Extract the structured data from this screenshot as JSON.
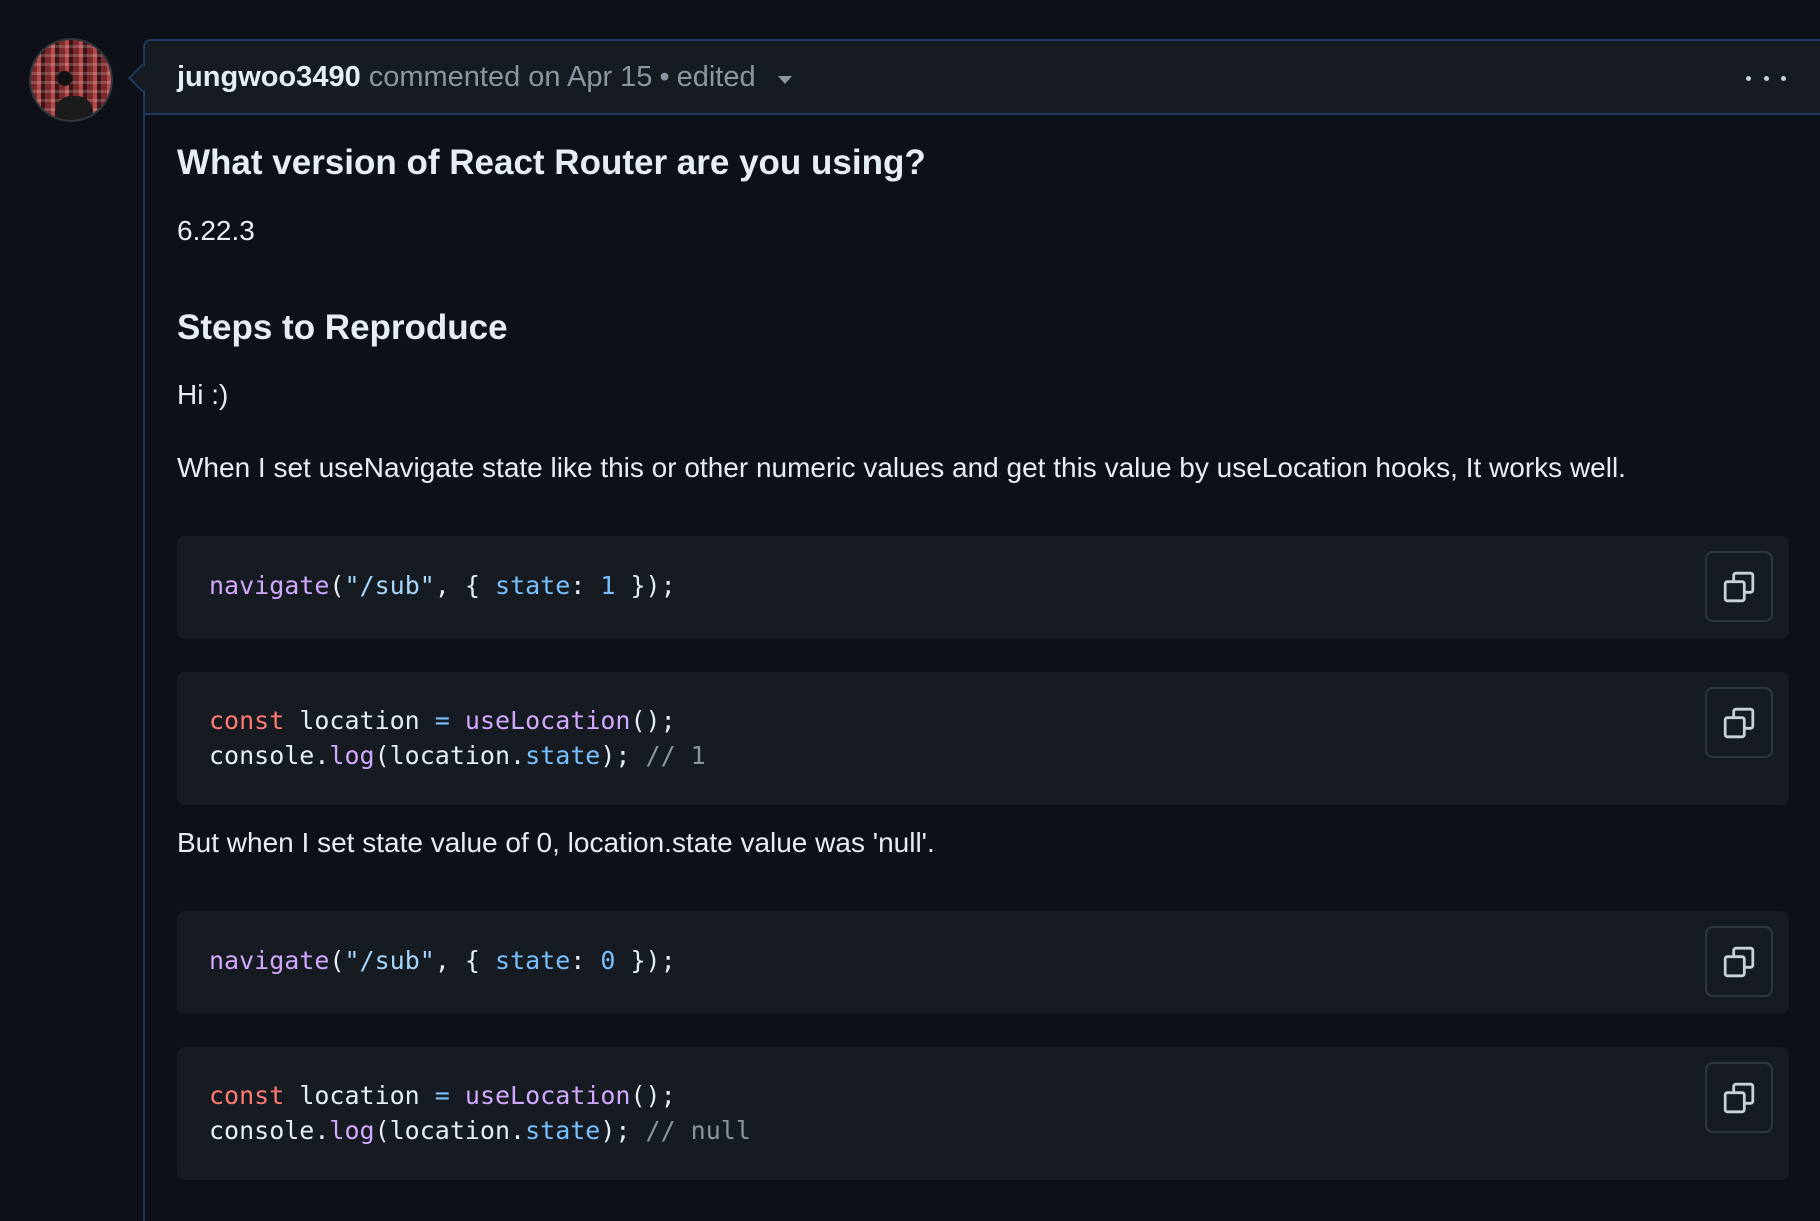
{
  "comment": {
    "author": "jungwoo3490",
    "action": "commented on Apr 15",
    "separator": "•",
    "edited_label": "edited"
  },
  "body": {
    "heading_version": "What version of React Router are you using?",
    "version": "6.22.3",
    "heading_steps": "Steps to Reproduce",
    "greeting": "Hi :)",
    "para_works": "When I set useNavigate state like this or other numeric values and get this value by useLocation hooks, It works well.",
    "para_null": "But when I set state value of 0, location.state value was 'null'.",
    "code_blocks": [
      "navigate(\"/sub\", { state: 1 });",
      "const location = useLocation();\nconsole.log(location.state); // 1",
      "navigate(\"/sub\", { state: 0 });",
      "const location = useLocation();\nconsole.log(location.state); // null"
    ]
  },
  "icons": {
    "kebab": "kebab-horizontal-icon",
    "copy": "copy-icon",
    "caret": "triangle-down-icon"
  },
  "colors": {
    "background": "#0d1117",
    "header_bg": "#161b22",
    "border_accent": "#1f3a5f",
    "keyword": "#ff7b72",
    "function": "#d2a8ff",
    "string": "#a5d6ff",
    "property": "#79c0ff",
    "comment": "#8b949e"
  }
}
